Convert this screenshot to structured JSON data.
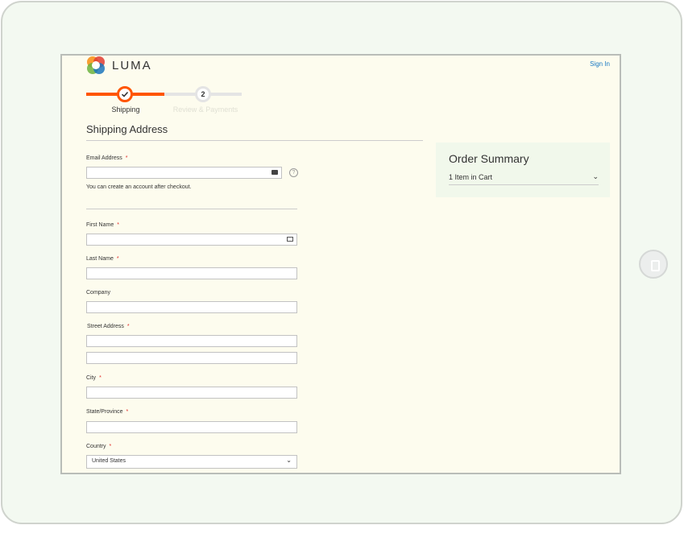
{
  "header": {
    "brand": "LUMA",
    "sign_in": "Sign In"
  },
  "progress": {
    "steps": [
      {
        "label": "Shipping",
        "state": "complete"
      },
      {
        "number": "2",
        "label": "Review & Payments",
        "state": "pending"
      }
    ]
  },
  "shipping": {
    "title": "Shipping Address",
    "email": {
      "label": "Email Address",
      "required": "*",
      "value": "",
      "note": "You can create an account after checkout."
    },
    "first_name": {
      "label": "First Name",
      "required": "*",
      "value": ""
    },
    "last_name": {
      "label": "Last Name",
      "required": "*",
      "value": ""
    },
    "company": {
      "label": "Company",
      "value": ""
    },
    "street": {
      "label": "Street Address",
      "required": "*",
      "line1": "",
      "line2": ""
    },
    "city": {
      "label": "City",
      "required": "*",
      "value": ""
    },
    "state": {
      "label": "State/Province",
      "required": "*",
      "value": ""
    },
    "country": {
      "label": "Country",
      "required": "*",
      "value": "United States"
    }
  },
  "order_summary": {
    "title": "Order Summary",
    "items_in_cart": "1 Item in Cart"
  },
  "colors": {
    "accent": "#ff5501",
    "link": "#1979c3",
    "required": "#e02b27",
    "page_bg": "#fdfcee",
    "summary_bg": "#f1f8eb"
  },
  "icons": [
    "luma-logo-icon",
    "checkmark-icon",
    "credit-card-icon",
    "help-icon",
    "contact-card-icon",
    "chevron-down-icon",
    "home-button-icon"
  ]
}
